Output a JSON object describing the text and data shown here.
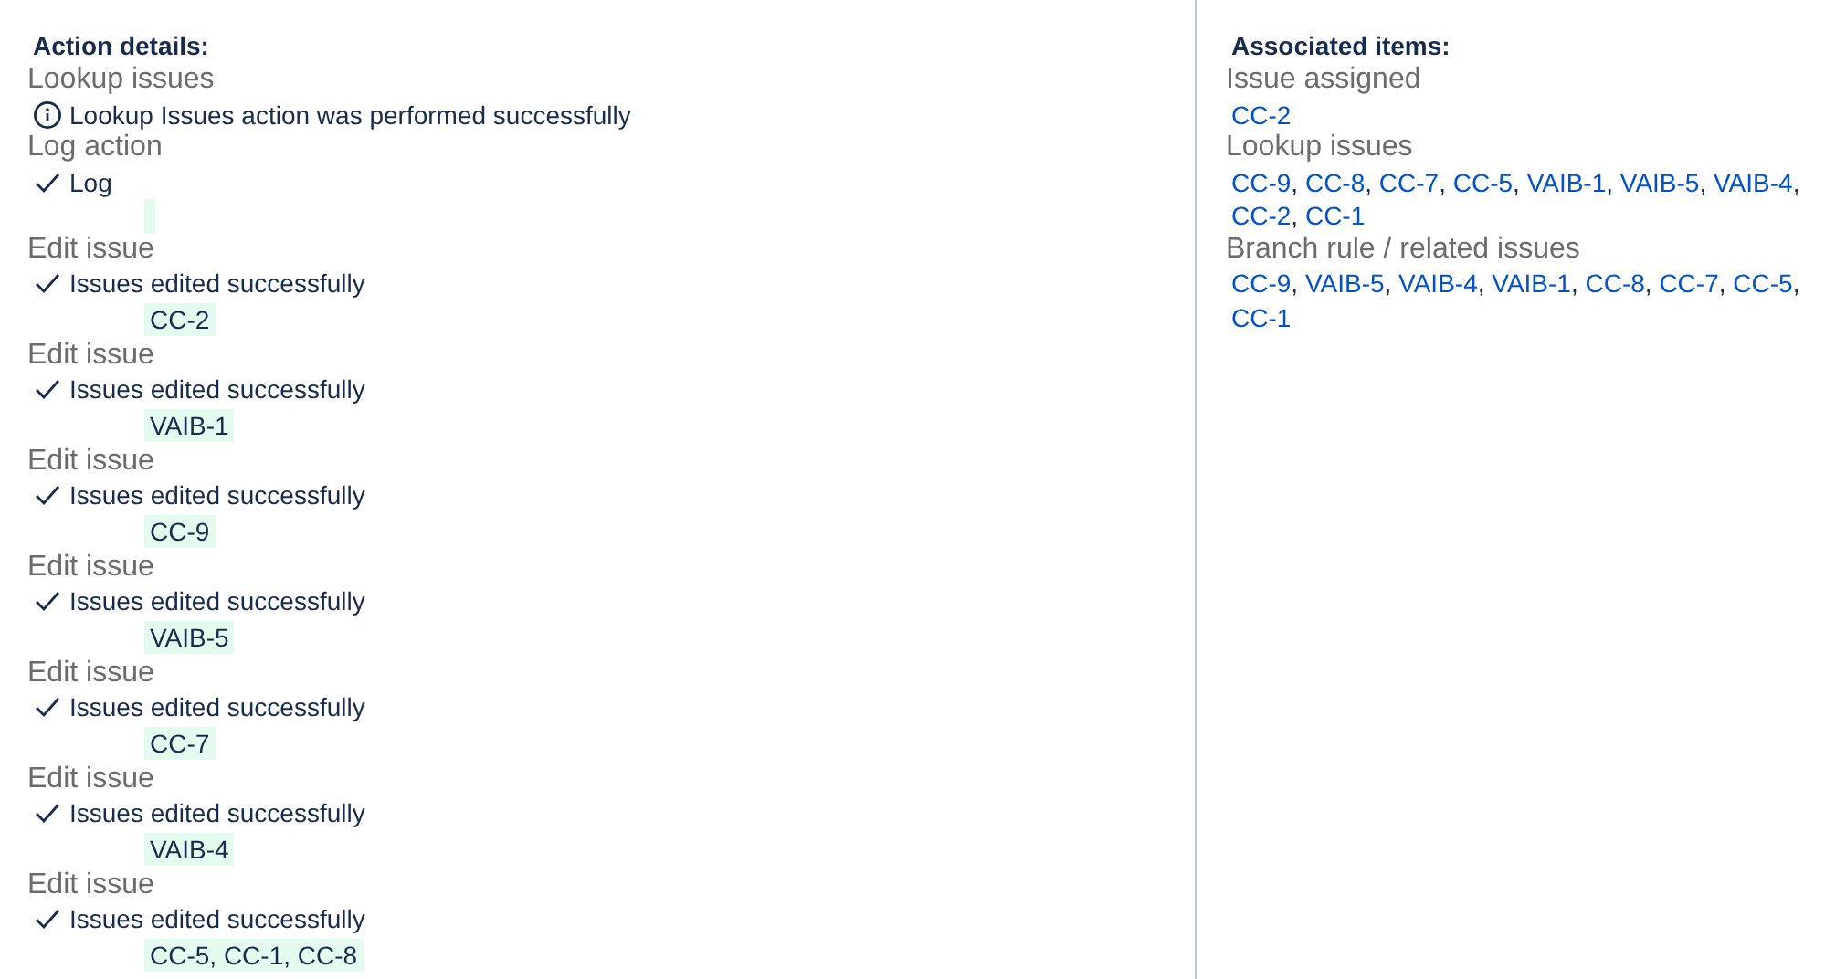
{
  "action_details": {
    "heading": "Action details:",
    "actions": [
      {
        "title": "Lookup issues",
        "kind": "info",
        "message": "Lookup Issues action was performed successfully"
      },
      {
        "title": "Log action",
        "kind": "check",
        "message": "Log",
        "empty_block": true
      },
      {
        "title": "Edit issue",
        "kind": "check",
        "message": "Issues edited successfully",
        "issues": "CC-2"
      },
      {
        "title": "Edit issue",
        "kind": "check",
        "message": "Issues edited successfully",
        "issues": "VAIB-1"
      },
      {
        "title": "Edit issue",
        "kind": "check",
        "message": "Issues edited successfully",
        "issues": "CC-9"
      },
      {
        "title": "Edit issue",
        "kind": "check",
        "message": "Issues edited successfully",
        "issues": "VAIB-5"
      },
      {
        "title": "Edit issue",
        "kind": "check",
        "message": "Issues edited successfully",
        "issues": "CC-7"
      },
      {
        "title": "Edit issue",
        "kind": "check",
        "message": "Issues edited successfully",
        "issues": "VAIB-4"
      },
      {
        "title": "Edit issue",
        "kind": "check",
        "message": "Issues edited successfully",
        "issues": "CC-5, CC-1, CC-8"
      }
    ]
  },
  "associated_items": {
    "heading": "Associated items:",
    "separator": ",",
    "groups": [
      {
        "title": "Issue assigned",
        "links": [
          "CC-2"
        ]
      },
      {
        "title": "Lookup issues",
        "links": [
          "CC-9",
          "CC-8",
          "CC-7",
          "CC-5",
          "VAIB-1",
          "VAIB-5",
          "VAIB-4",
          "CC-2",
          "CC-1"
        ]
      },
      {
        "title": "Branch rule / related issues",
        "links": [
          "CC-9",
          "VAIB-5",
          "VAIB-4",
          "VAIB-1",
          "CC-8",
          "CC-7",
          "CC-5",
          "CC-1"
        ]
      }
    ]
  }
}
